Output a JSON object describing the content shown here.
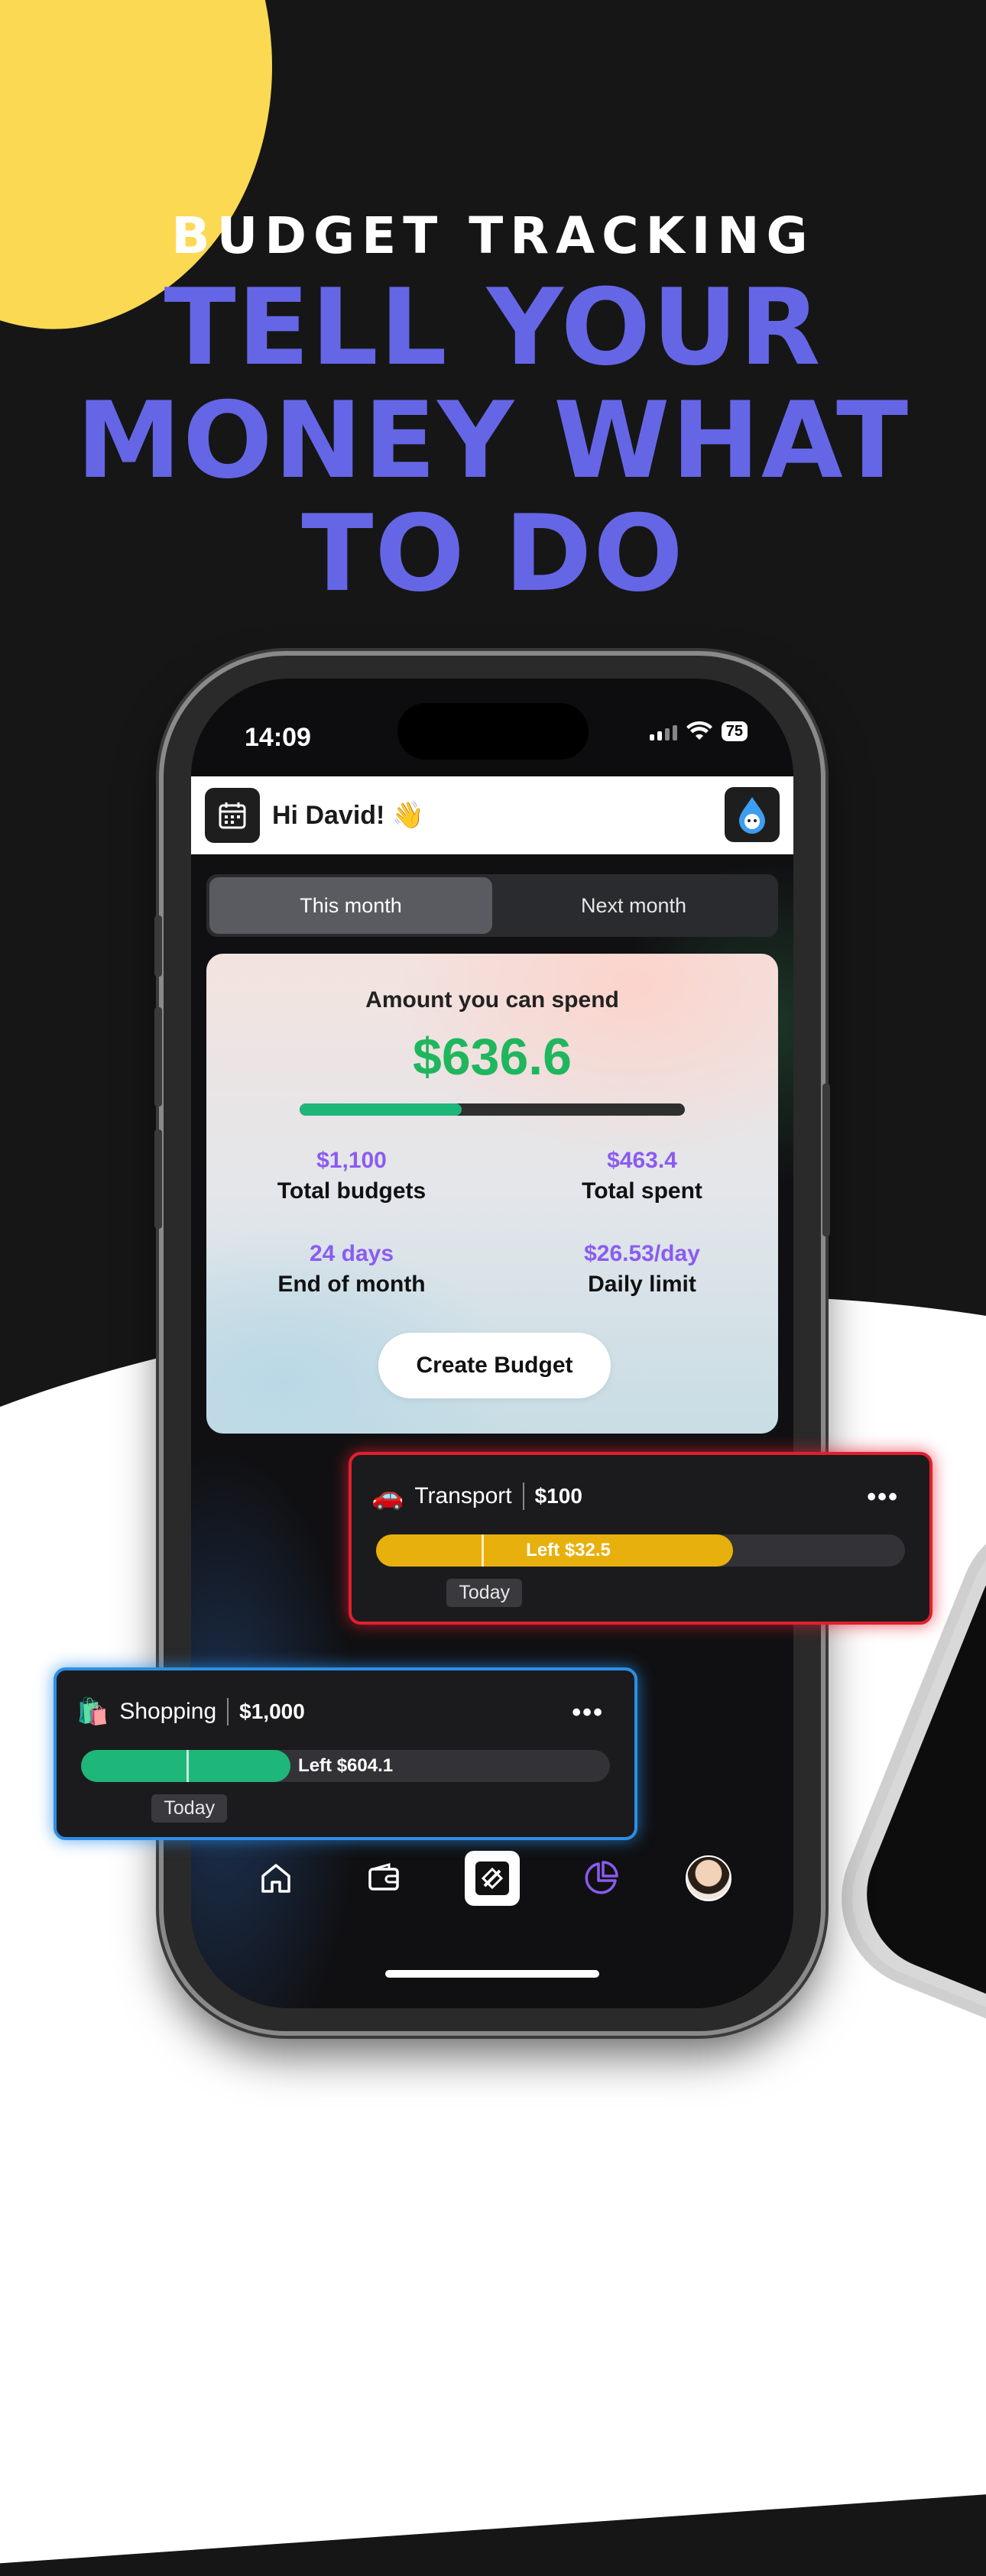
{
  "promo": {
    "subtitle": "BUDGET TRACKING",
    "headline_lines": [
      "TELL YOUR",
      "MONEY WHAT",
      "TO DO"
    ],
    "colors": {
      "accent": "#6566e6",
      "blob": "#fbd953",
      "background": "#161616"
    }
  },
  "status_bar": {
    "time": "14:09",
    "battery": "75"
  },
  "header": {
    "greeting": "Hi David! 👋"
  },
  "tabs": [
    {
      "label": "This month",
      "active": true
    },
    {
      "label": "Next month",
      "active": false
    }
  ],
  "summary": {
    "title": "Amount you can spend",
    "amount": "$636.6",
    "progress_fraction": 0.42,
    "stats": [
      {
        "value": "$1,100",
        "label": "Total budgets"
      },
      {
        "value": "$463.4",
        "label": "Total spent"
      },
      {
        "value": "24 days",
        "label": "End of month"
      },
      {
        "value": "$26.53/day",
        "label": "Daily limit"
      }
    ],
    "create_button": "Create Budget"
  },
  "budgets": {
    "transport": {
      "emoji": "🚗",
      "name": "Transport",
      "amount": "$100",
      "left_label": "Left $32.5",
      "fill_fraction": 0.675,
      "today_fraction": 0.2,
      "today_label": "Today",
      "color": "#e8b00c",
      "border_color": "#e0202e"
    },
    "shopping": {
      "emoji": "🛍️",
      "name": "Shopping",
      "amount": "$1,000",
      "left_label": "Left $604.1",
      "fill_fraction": 0.396,
      "today_fraction": 0.2,
      "today_label": "Today",
      "color": "#1fb67a",
      "border_color": "#2b8fe6"
    }
  },
  "nav": {
    "items": [
      "home-icon",
      "wallet-icon",
      "scan-icon",
      "budget-pie-icon",
      "profile-avatar"
    ],
    "active": "budget-pie-icon",
    "active_color": "#8a5cf0"
  }
}
